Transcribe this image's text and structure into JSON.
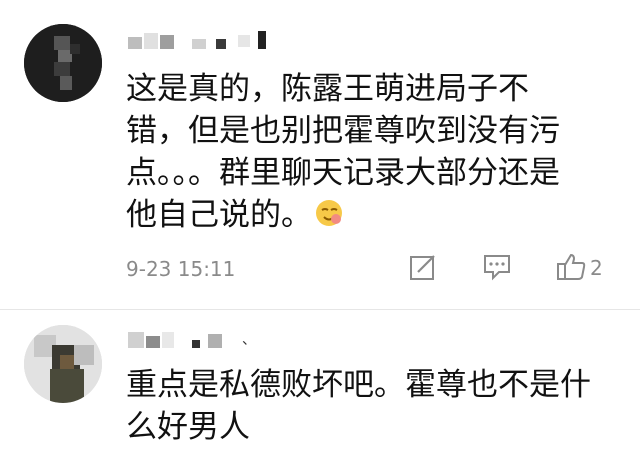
{
  "comments": [
    {
      "username": "",
      "body": "这是真的，陈露王萌进局子不\n错，但是也别把霍尊吹到没有污\n点。。。群里聊天记录大部分还是\n他自己说的。",
      "emoji": "smirk-emoji",
      "time": "9-23 15:11",
      "likes": "2",
      "icons": [
        "edit-icon",
        "comment-icon",
        "thumbs-up-icon"
      ]
    },
    {
      "username": "、",
      "body": "重点是私德败坏吧。霍尊也不是什\n么好男人"
    }
  ],
  "colors": {
    "text": "#111111",
    "meta": "#8a8a8a",
    "divider": "#e6e6e6"
  }
}
